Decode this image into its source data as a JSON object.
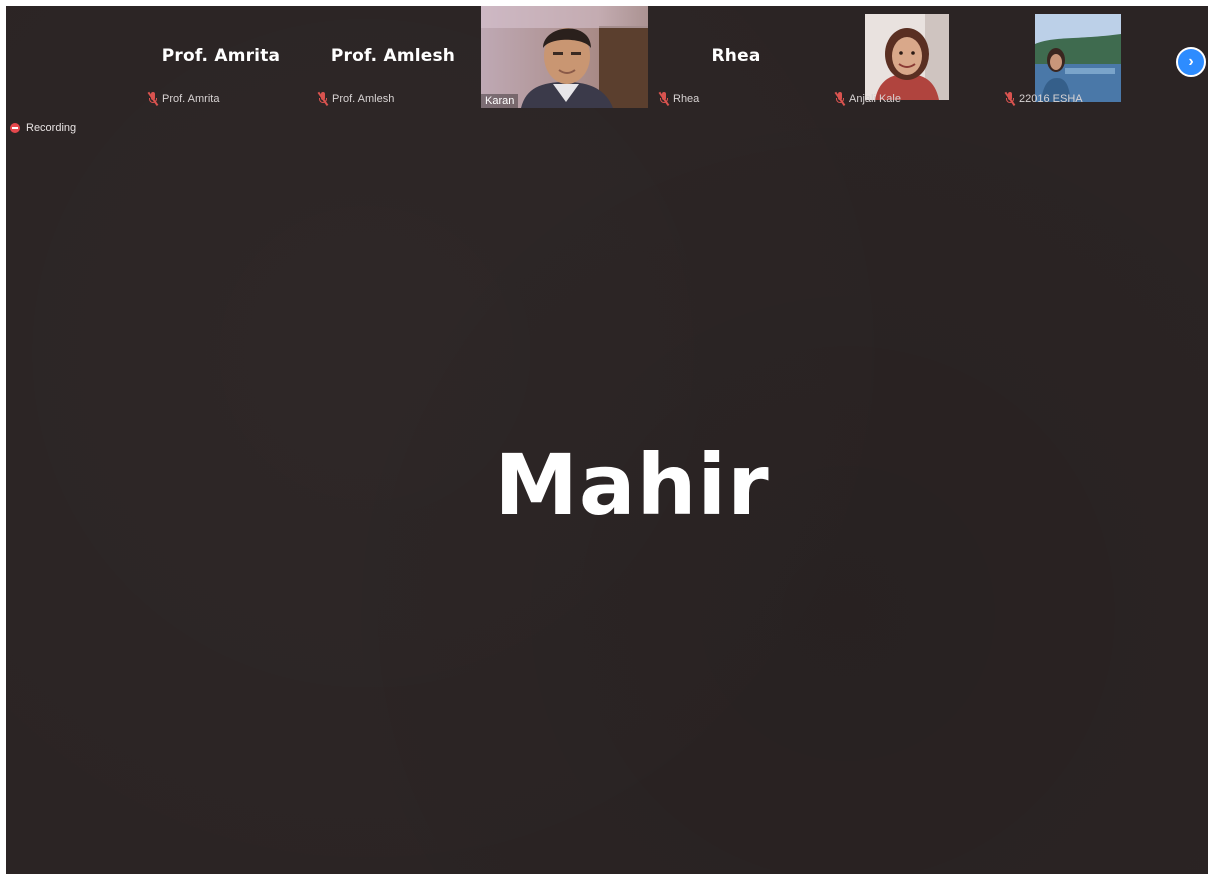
{
  "meeting": {
    "active_speaker": "Mahir",
    "recording_label": "Recording"
  },
  "participants": [
    {
      "display_name": "Prof. Amrita",
      "label": "Prof. Amrita",
      "muted": true,
      "video": false
    },
    {
      "display_name": "Prof. Amlesh",
      "label": "Prof. Amlesh",
      "muted": true,
      "video": false
    },
    {
      "display_name": "",
      "label": "Karan",
      "muted": false,
      "video": true
    },
    {
      "display_name": "Rhea",
      "label": "Rhea",
      "muted": true,
      "video": false
    },
    {
      "display_name": "",
      "label": "Anjali Kale",
      "muted": true,
      "video": true
    },
    {
      "display_name": "",
      "label": "22016 ESHA",
      "muted": true,
      "video": true
    }
  ],
  "colors": {
    "background": "#2b2424",
    "next_button": "#2d8cff",
    "muted_icon": "#d9534f",
    "recording_dot": "#e5484d"
  },
  "icons": {
    "next_page": "chevron-right-icon",
    "muted_mic": "mic-muted-icon",
    "recording": "record-dot-icon"
  }
}
